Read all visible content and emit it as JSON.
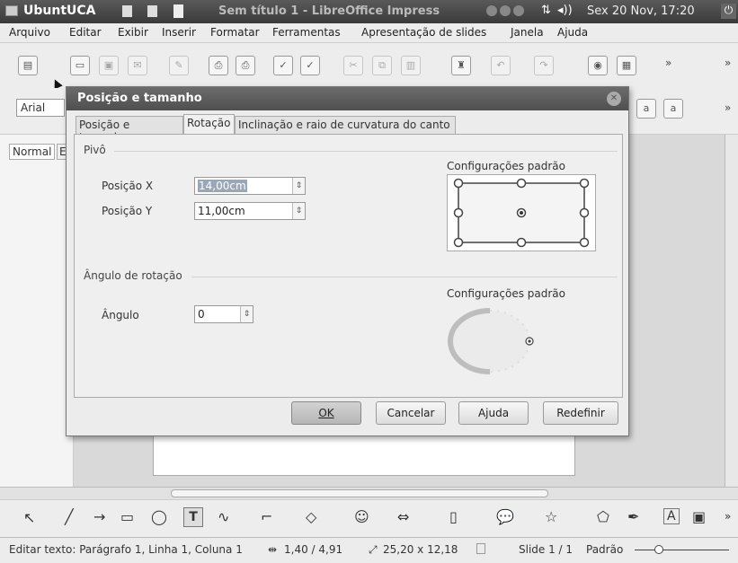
{
  "panel": {
    "app_name": "UbuntUCA",
    "window_title": "Sem título 1 - LibreOffice Impress",
    "clock": "Sex 20 Nov, 17:20"
  },
  "menu": [
    "Arquivo",
    "Editar",
    "Exibir",
    "Inserir",
    "Formatar",
    "Ferramentas",
    "Apresentação de slides",
    "Janela",
    "Ajuda"
  ],
  "toolbar2": {
    "font_name": "Arial"
  },
  "left_tabs": {
    "normal": "Normal",
    "partial": "Es"
  },
  "dialog": {
    "title": "Posição e tamanho",
    "tabs": [
      "Posição e tamanho",
      "Rotação",
      "Inclinação e raio de curvatura do canto"
    ],
    "active_tab": "Rotação",
    "pivot": {
      "section": "Pivô",
      "pos_x_label": "Posição X",
      "pos_x_value": "14,00cm",
      "pos_y_label": "Posição Y",
      "pos_y_value": "11,00cm",
      "defaults_label": "Configurações padrão"
    },
    "rotation": {
      "section": "Ângulo de rotação",
      "angle_label": "Ângulo",
      "angle_value": "0",
      "defaults_label": "Configurações padrão"
    },
    "buttons": {
      "ok": "OK",
      "cancel": "Cancelar",
      "help": "Ajuda",
      "reset": "Redefinir"
    }
  },
  "status": {
    "edit_text": "Editar texto: Parágrafo 1, Linha 1, Coluna 1",
    "position": "1,40 / 4,91",
    "size": "25,20 x 12,18",
    "slide": "Slide 1 / 1",
    "layout": "Padrão"
  }
}
